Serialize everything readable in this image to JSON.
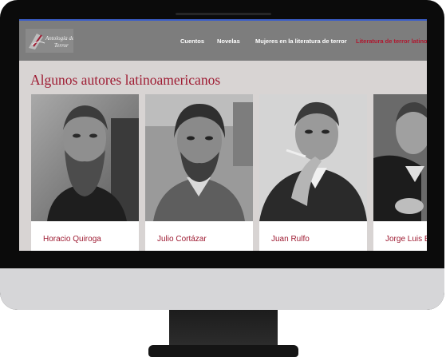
{
  "site": {
    "logo_text": "Antología de Terror"
  },
  "nav": {
    "items": [
      {
        "label": "Cuentos"
      },
      {
        "label": "Novelas"
      },
      {
        "label": "Mujeres en la literatura de terror"
      },
      {
        "label": "Literatura de terror latinoamericana"
      }
    ]
  },
  "main": {
    "title": "Algunos autores latinoamericanos",
    "authors": [
      {
        "name": "Horacio Quiroga"
      },
      {
        "name": "Julio Cortázar"
      },
      {
        "name": "Juan Rulfo"
      },
      {
        "name": "Jorge Luis Borges"
      }
    ]
  },
  "colors": {
    "accent": "#9e1b32",
    "navbar": "#7d7d7d",
    "page_bg": "#d8d4d3"
  }
}
